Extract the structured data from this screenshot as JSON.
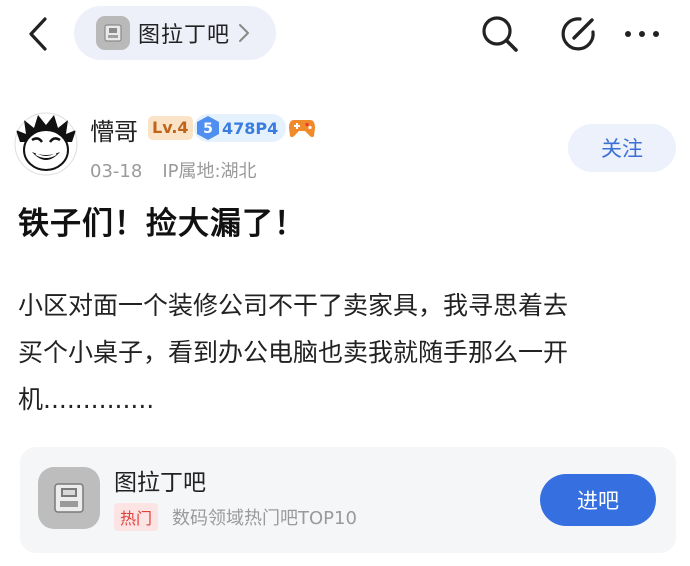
{
  "header": {
    "forum_name": "图拉丁吧",
    "icons": [
      "back-icon",
      "chevron-right-icon",
      "search-icon",
      "compose-icon",
      "more-icon"
    ]
  },
  "author": {
    "name": "懵哥",
    "level": "Lv.4",
    "gem_level": "5",
    "gem_text": "478P4",
    "date": "03-18",
    "ip_location": "IP属地:湖北",
    "follow_label": "关注"
  },
  "post": {
    "title": "铁子们！捡大漏了！",
    "body_lines": [
      "小区对面一个装修公司不干了卖家具，我寻思着去",
      "买个小桌子，看到办公电脑也卖我就随手那么一开",
      "机.............."
    ]
  },
  "forum_card": {
    "name": "图拉丁吧",
    "tag": "热门",
    "description": "数码领域热门吧TOP10",
    "enter_label": "进吧"
  },
  "colors": {
    "accent_blue": "#3670e0",
    "follow_text": "#3c6fd6",
    "level_badge_bg": "#fbe3c8",
    "level_badge_text": "#c0641a",
    "hot_tag_text": "#e0403a",
    "meta_gray": "#9a9a9a"
  }
}
